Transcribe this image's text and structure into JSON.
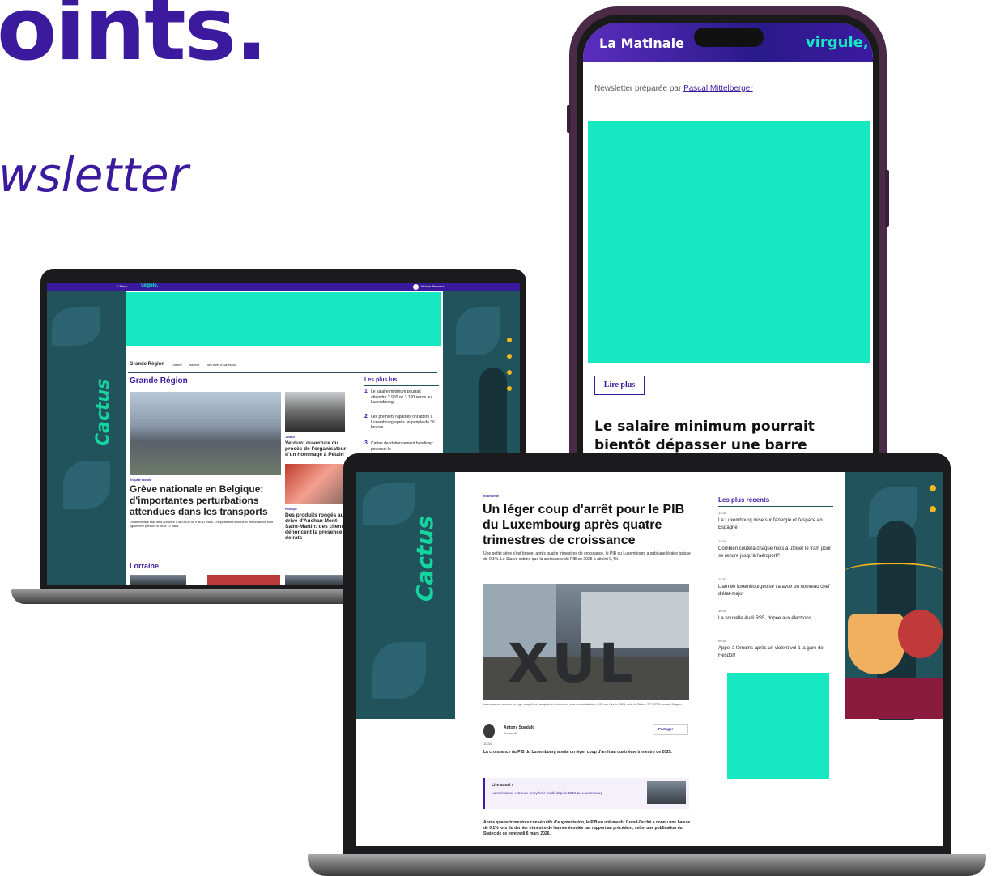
{
  "hero": {
    "headline_fragment": "oints.",
    "subheadline_fragment": "wsletter"
  },
  "laptop_small": {
    "topbar": {
      "menu": "≡ Menu",
      "logo": "virgule,",
      "account": "Jérôme Bernard"
    },
    "brand": "Cactus",
    "section_nav": {
      "title": "Grande Région",
      "links": [
        "Lorraine",
        "Wallonie",
        "de Trèves à Sarrebruck"
      ]
    },
    "section_title": "Grande Région",
    "lead_story": {
      "category": "Enquête sociale",
      "title": "Grève nationale en Belgique: d'importantes perturbations attendues dans les transports",
      "summary": "Un débrayage était déjà annoncé à la SNCB du 9 au 11 mars. D'importantes actions et perturbations sont également prévues le jeudi 13 mars."
    },
    "side_story_1": {
      "category": "Justice",
      "title": "Verdun: ouverture du procès de l'organisateur d'un hommage à Pétain"
    },
    "side_story_2": {
      "category": "Politique",
      "title": "Des produits rongés au drive d'Auchan Mont-Saint-Martin: des clients dénoncent la présence de rats"
    },
    "most_read": {
      "title": "Les plus lus",
      "items": [
        {
          "num": "1",
          "text": "Le salaire minimum pourrait atteindre 2.900 ou 3.100 euros au Luxembourg"
        },
        {
          "num": "2",
          "text": "Les premiers rapatriés ont atterri à Luxembourg après un périple de 36 heures"
        },
        {
          "num": "3",
          "text": "Cartes de stationnement handicap: pourquoi le"
        }
      ]
    },
    "footer_section": "Lorraine"
  },
  "phone": {
    "brand": "La Matinale",
    "partner": "virgule,",
    "prepared_by_label": "Newsletter préparée par",
    "prepared_by_name": "Pascal Mittelberger",
    "read_more": "Lire plus",
    "headline": "Le salaire minimum pourrait bientôt dépasser une barre symbolique au"
  },
  "laptop_large": {
    "brand": "Cactus",
    "article": {
      "category": "Économie",
      "title": "Un léger coup d'arrêt pour le PIB du Luxembourg après quatre trimestres de croissance",
      "lede": "Une petite série s'est brisée: après quatre trimestres de croissance, le PIB du Luxembourg a subi une légère baisse de 0,1%. Le Statec estime que la croissance du PIB en 2025 a atteint 0,4%.",
      "photo_text": "XUL",
      "caption": "La croissance a connu un léger coup d'arrêt au quatrième trimestre, mais devrait atteindre 0,5% sur l'année 2025, selon le Statec. © PHOTO: Armand Wagner",
      "author_name": "Antony Spadafo",
      "author_role": "Journaliste",
      "share": "Partager",
      "time": "10:34",
      "intro": "La croissance du PIB du Luxembourg a subi un léger coup d'arrêt au quatrième trimestre de 2025.",
      "read_also_label": "Lire aussi :",
      "read_also_link": "La croissance retrouve un rythme inédit depuis 2019 au Luxembourg",
      "body": "Après quatre trimestres consécutifs d'augmentation, le PIB en volume du Grand-Duché a connu une baisse de 0,1% lors du dernier trimestre de l'année écoulée par rapport au précédent, selon une publication du Statec de ce vendredi 6 mars 2026."
    },
    "recent": {
      "title": "Les plus récents",
      "items": [
        {
          "time": "12:30",
          "text": "Le Luxembourg mise sur l'énergie et l'espace en Espagne"
        },
        {
          "time": "12:00",
          "text": "Combien coûtera chaque mois à utiliser le tram pour se rendre jusqu'à l'aéroport?"
        },
        {
          "time": "11:30",
          "text": "L'armée luxembourgeoise va avoir un nouveau chef d'état-major"
        },
        {
          "time": "10:30",
          "text": "La nouvelle Audi RS5, dopée aux électrons"
        },
        {
          "time": "09:30",
          "text": "Appel à témoins après un violent vol à la gare de Hesdorf"
        }
      ]
    }
  },
  "colors": {
    "brand_purple": "#3b1a9e",
    "teal_placeholder": "#16e8c2",
    "dark_teal_bg": "#21535d",
    "accent_yellow": "#f4b81c"
  }
}
